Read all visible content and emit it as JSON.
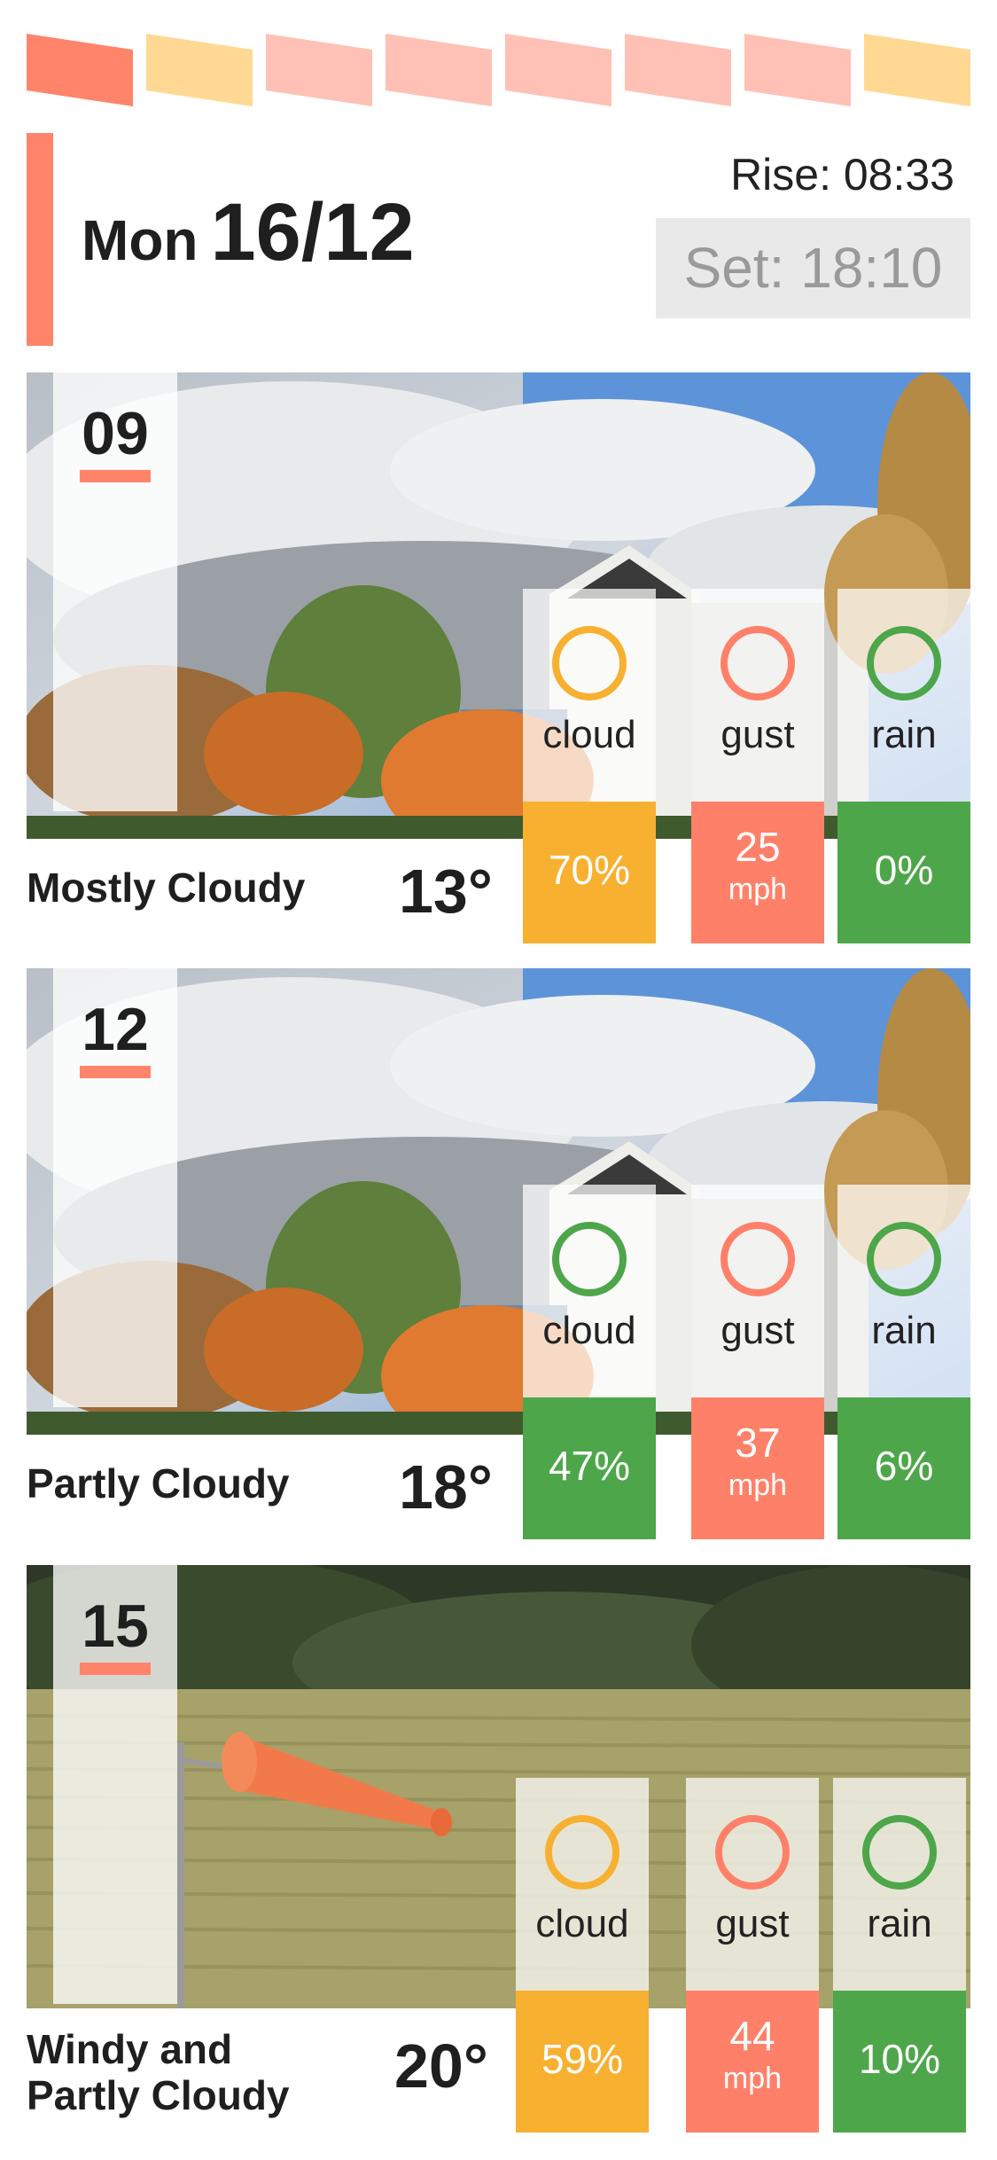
{
  "day_tabs": [
    {
      "color": "#ff8469"
    },
    {
      "color": "#ffd993"
    },
    {
      "color": "#ffc1b5"
    },
    {
      "color": "#ffc1b5"
    },
    {
      "color": "#ffc1b5"
    },
    {
      "color": "#ffc1b5"
    },
    {
      "color": "#ffc1b5"
    },
    {
      "color": "#ffd993"
    }
  ],
  "header": {
    "day": "Mon",
    "date": "16/12",
    "sunrise": "Rise: 08:33",
    "sunset": "Set: 18:10"
  },
  "forecasts": [
    {
      "hour": "09",
      "description": "Mostly Cloudy",
      "temperature": "13°",
      "cloud": {
        "label": "cloud",
        "value": "70%",
        "status": "orange"
      },
      "gust": {
        "label": "gust",
        "value": "25",
        "unit": "mph",
        "status": "red"
      },
      "rain": {
        "label": "rain",
        "value": "0%",
        "status": "green"
      },
      "photo": "cloudy-park-building"
    },
    {
      "hour": "12",
      "description": "Partly Cloudy",
      "temperature": "18°",
      "cloud": {
        "label": "cloud",
        "value": "47%",
        "status": "green"
      },
      "gust": {
        "label": "gust",
        "value": "37",
        "unit": "mph",
        "status": "red"
      },
      "rain": {
        "label": "rain",
        "value": "6%",
        "status": "green"
      },
      "photo": "cloudy-park-building"
    },
    {
      "hour": "15",
      "description_line1": "Windy and",
      "description_line2": "Partly Cloudy",
      "temperature": "20°",
      "cloud": {
        "label": "cloud",
        "value": "59%",
        "status": "orange"
      },
      "gust": {
        "label": "gust",
        "value": "44",
        "unit": "mph",
        "status": "red"
      },
      "rain": {
        "label": "rain",
        "value": "10%",
        "status": "green"
      },
      "photo": "windsock-field"
    }
  ],
  "colors": {
    "orange": "#f8b031",
    "red": "#ff8069",
    "green": "#4ea64a",
    "accent": "#ff8469"
  }
}
